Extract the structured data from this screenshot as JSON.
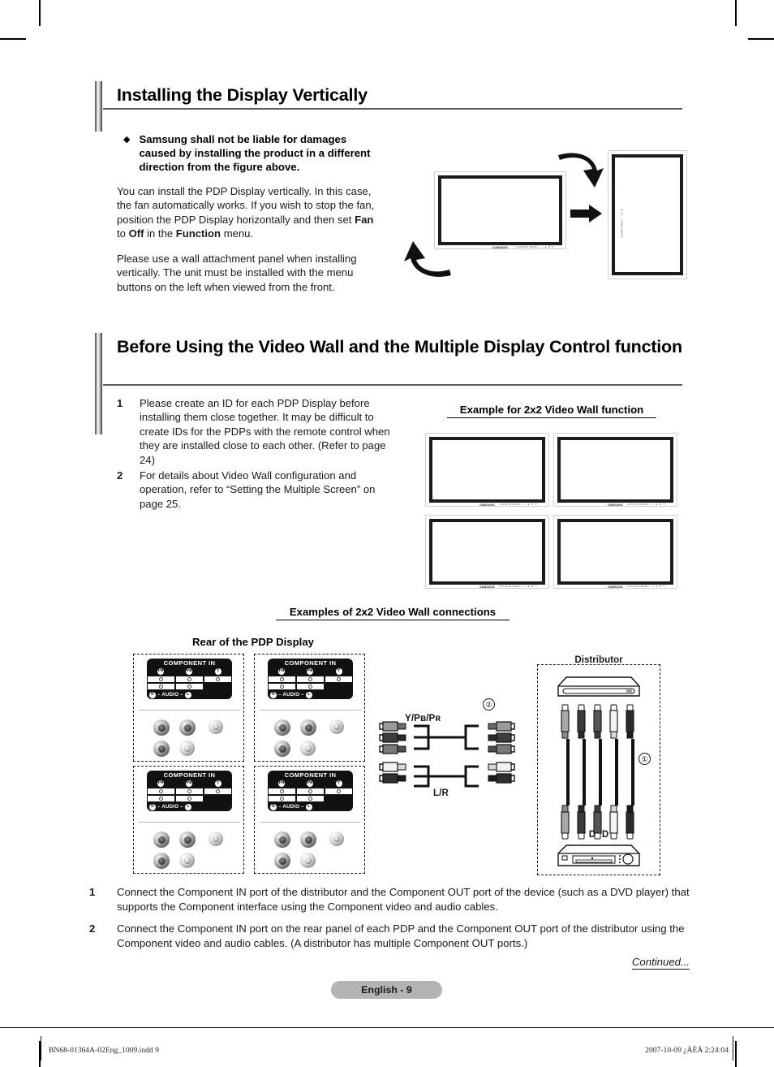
{
  "page": {
    "language_badge": "English - 9",
    "continued_label": "Continued..."
  },
  "footer": {
    "file": "BN68-01364A-02Eng_1009.indd   9",
    "stamp": "2007-10-09   ¿ÀÈÄ 2:24:04"
  },
  "section1": {
    "title": "Installing the Display Vertically",
    "bullet_glyph": "◆",
    "bullet": "Samsung shall not be liable for damages caused by installing the product in a different direction from the figure above.",
    "para1_a": "You can install the PDP Display vertically. In this case, the fan automatically works. If you wish to stop the fan, position the PDP Display horizontally and then set ",
    "para1_b": "Fan",
    "para1_c": " to ",
    "para1_d": "Off",
    "para1_e": " in the ",
    "para1_f": "Function",
    "para1_g": " menu.",
    "para2": "Please use a wall attachment panel when installing vertically. The unit must be installed with the menu buttons on the left when viewed from the front.",
    "figure": {
      "landscape_brand": "SAMSUNG",
      "landscape_buttons": "SOURCE  MENU  −  +  ▲  ▼  ⏻",
      "portrait_brand": "SAMSUNG",
      "portrait_buttons": "SOURCE MENU − + ▲ ▼"
    }
  },
  "section2": {
    "title": "Before Using the Video Wall and the Multiple Display Control function",
    "items": [
      {
        "n": "1",
        "text": "Please create an ID for each PDP Display before installing them close together. It may be difficult to create IDs for the PDPs with the remote control when they are installed close to each other. (Refer to page 24)"
      },
      {
        "n": "2",
        "text": "For details about Video Wall configuration and operation, refer to “Setting the Multiple Screen” on page 25."
      }
    ],
    "videowall_caption": "Example for 2x2 Video Wall function",
    "videowall_brand": "SAMSUNG",
    "videowall_buttons": "SOURCE MENU − + ▲ ▼ ⏻",
    "connections_caption": "Examples of 2x2 Video Wall connections",
    "rear_caption": "Rear of the PDP Display",
    "panel": {
      "title": "COMPONENT IN",
      "jacks": [
        "Pʀ",
        "Pʙ",
        "Y"
      ],
      "audio_r": "R",
      "audio_text": "– AUDIO –",
      "audio_l": "L"
    },
    "cable_labels": {
      "component": "Y/Pʙ/Pʀ",
      "component_sub_b": "B",
      "component_sub_r": "R",
      "audio": "L/R",
      "marker_1": "①",
      "marker_2": "②"
    },
    "devices": {
      "distributor": "Distributor",
      "dvd": "DVD"
    },
    "bottom_items": [
      {
        "n": "1",
        "text": "Connect the Component IN port of the distributor and the Component OUT port of the device (such as a DVD player) that supports the Component interface using the Component video and audio cables."
      },
      {
        "n": "2",
        "text": "Connect the Component IN port on the rear panel of each PDP and the Component OUT port of the distributor using the Component video and audio cables. (A distributor has multiple Component OUT ports.)"
      }
    ]
  }
}
